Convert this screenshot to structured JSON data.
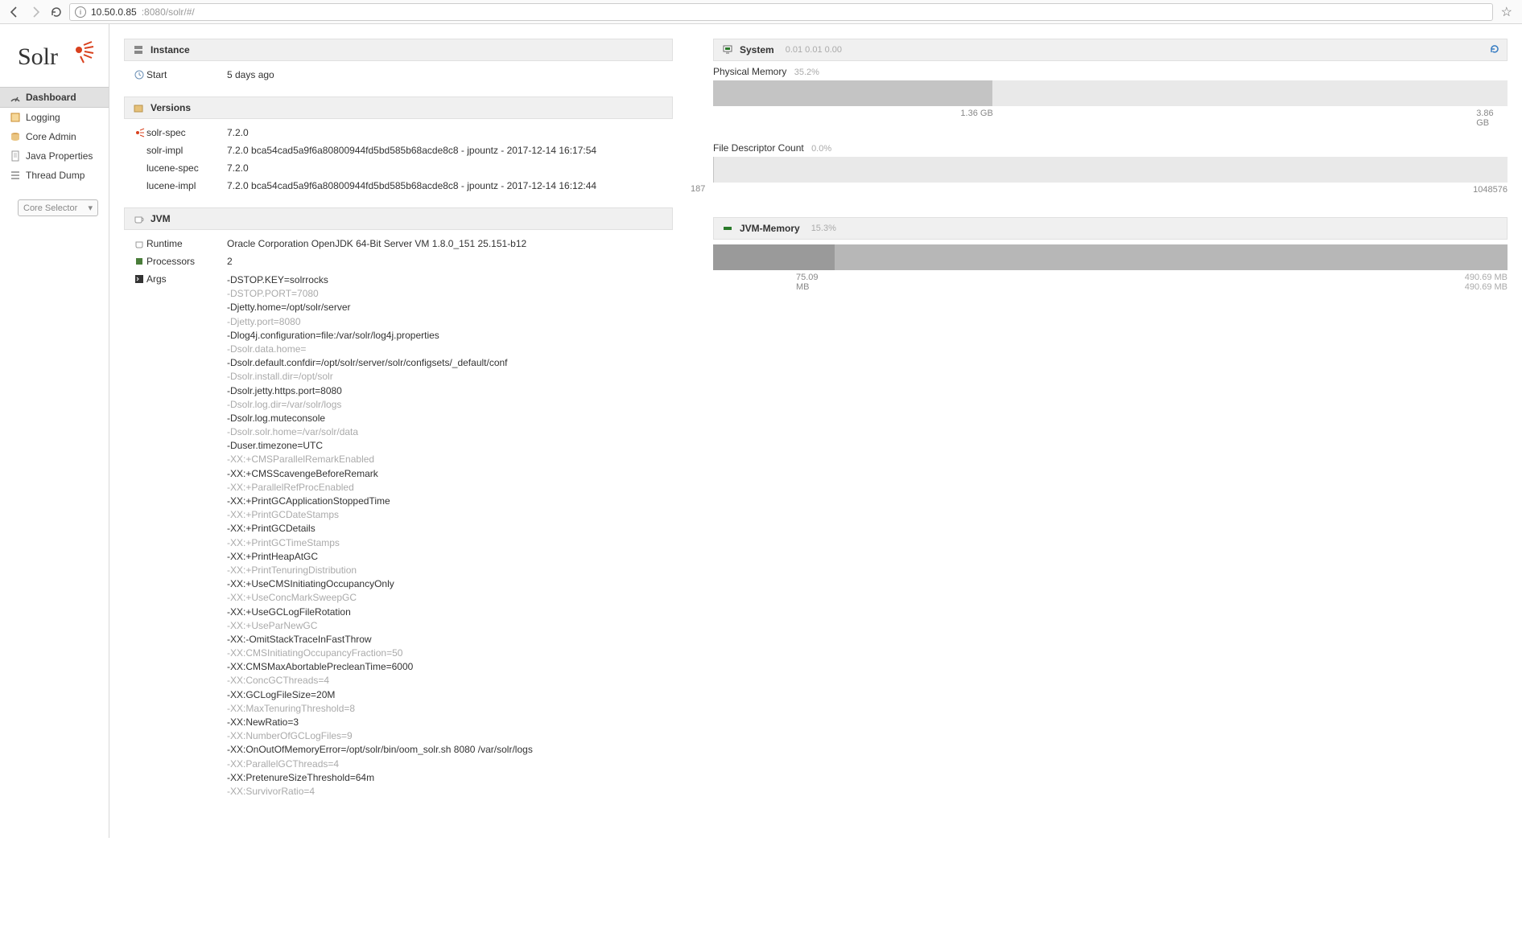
{
  "browser": {
    "url_prefix_dim": "",
    "url_host": "10.50.0.85",
    "url_port_path": ":8080/solr/#/"
  },
  "logo_alt": "Solr",
  "nav": {
    "items": [
      {
        "label": "Dashboard"
      },
      {
        "label": "Logging"
      },
      {
        "label": "Core Admin"
      },
      {
        "label": "Java Properties"
      },
      {
        "label": "Thread Dump"
      }
    ],
    "core_selector": "Core Selector"
  },
  "instance": {
    "title": "Instance",
    "start_label": "Start",
    "start_value": "5 days ago"
  },
  "versions": {
    "title": "Versions",
    "rows": [
      {
        "name": "solr-spec",
        "value": "7.2.0"
      },
      {
        "name": "solr-impl",
        "value": "7.2.0 bca54cad5a9f6a80800944fd5bd585b68acde8c8 - jpountz - 2017-12-14 16:17:54"
      },
      {
        "name": "lucene-spec",
        "value": "7.2.0"
      },
      {
        "name": "lucene-impl",
        "value": "7.2.0 bca54cad5a9f6a80800944fd5bd585b68acde8c8 - jpountz - 2017-12-14 16:12:44"
      }
    ]
  },
  "jvm": {
    "title": "JVM",
    "runtime_label": "Runtime",
    "runtime_value": "Oracle Corporation OpenJDK 64-Bit Server VM 1.8.0_151 25.151-b12",
    "processors_label": "Processors",
    "processors_value": "2",
    "args_label": "Args",
    "args": [
      {
        "t": "-DSTOP.KEY=solrrocks",
        "dim": false
      },
      {
        "t": "-DSTOP.PORT=7080",
        "dim": true
      },
      {
        "t": "-Djetty.home=/opt/solr/server",
        "dim": false
      },
      {
        "t": "-Djetty.port=8080",
        "dim": true
      },
      {
        "t": "-Dlog4j.configuration=file:/var/solr/log4j.properties",
        "dim": false
      },
      {
        "t": "-Dsolr.data.home=",
        "dim": true
      },
      {
        "t": "-Dsolr.default.confdir=/opt/solr/server/solr/configsets/_default/conf",
        "dim": false
      },
      {
        "t": "-Dsolr.install.dir=/opt/solr",
        "dim": true
      },
      {
        "t": "-Dsolr.jetty.https.port=8080",
        "dim": false
      },
      {
        "t": "-Dsolr.log.dir=/var/solr/logs",
        "dim": true
      },
      {
        "t": "-Dsolr.log.muteconsole",
        "dim": false
      },
      {
        "t": "-Dsolr.solr.home=/var/solr/data",
        "dim": true
      },
      {
        "t": "-Duser.timezone=UTC",
        "dim": false
      },
      {
        "t": "-XX:+CMSParallelRemarkEnabled",
        "dim": true
      },
      {
        "t": "-XX:+CMSScavengeBeforeRemark",
        "dim": false
      },
      {
        "t": "-XX:+ParallelRefProcEnabled",
        "dim": true
      },
      {
        "t": "-XX:+PrintGCApplicationStoppedTime",
        "dim": false
      },
      {
        "t": "-XX:+PrintGCDateStamps",
        "dim": true
      },
      {
        "t": "-XX:+PrintGCDetails",
        "dim": false
      },
      {
        "t": "-XX:+PrintGCTimeStamps",
        "dim": true
      },
      {
        "t": "-XX:+PrintHeapAtGC",
        "dim": false
      },
      {
        "t": "-XX:+PrintTenuringDistribution",
        "dim": true
      },
      {
        "t": "-XX:+UseCMSInitiatingOccupancyOnly",
        "dim": false
      },
      {
        "t": "-XX:+UseConcMarkSweepGC",
        "dim": true
      },
      {
        "t": "-XX:+UseGCLogFileRotation",
        "dim": false
      },
      {
        "t": "-XX:+UseParNewGC",
        "dim": true
      },
      {
        "t": "-XX:-OmitStackTraceInFastThrow",
        "dim": false
      },
      {
        "t": "-XX:CMSInitiatingOccupancyFraction=50",
        "dim": true
      },
      {
        "t": "-XX:CMSMaxAbortablePrecleanTime=6000",
        "dim": false
      },
      {
        "t": "-XX:ConcGCThreads=4",
        "dim": true
      },
      {
        "t": "-XX:GCLogFileSize=20M",
        "dim": false
      },
      {
        "t": "-XX:MaxTenuringThreshold=8",
        "dim": true
      },
      {
        "t": "-XX:NewRatio=3",
        "dim": false
      },
      {
        "t": "-XX:NumberOfGCLogFiles=9",
        "dim": true
      },
      {
        "t": "-XX:OnOutOfMemoryError=/opt/solr/bin/oom_solr.sh 8080 /var/solr/logs",
        "dim": false
      },
      {
        "t": "-XX:ParallelGCThreads=4",
        "dim": true
      },
      {
        "t": "-XX:PretenureSizeThreshold=64m",
        "dim": false
      },
      {
        "t": "-XX:SurvivorRatio=4",
        "dim": true
      }
    ]
  },
  "system": {
    "title": "System",
    "load": "0.01 0.01 0.00",
    "phys_mem_label": "Physical Memory",
    "phys_mem_pct": "35.2%",
    "phys_mem_used": "1.36 GB",
    "phys_mem_total": "3.86 GB",
    "phys_mem_width": "35.2%",
    "fd_label": "File Descriptor Count",
    "fd_pct": "0.0%",
    "fd_used": "187",
    "fd_total": "1048576",
    "fd_width": "0.02%"
  },
  "jvmmem": {
    "title": "JVM-Memory",
    "pct": "15.3%",
    "used": "75.09 MB",
    "committed": "490.69 MB",
    "max": "490.69 MB",
    "width": "15.3%"
  }
}
